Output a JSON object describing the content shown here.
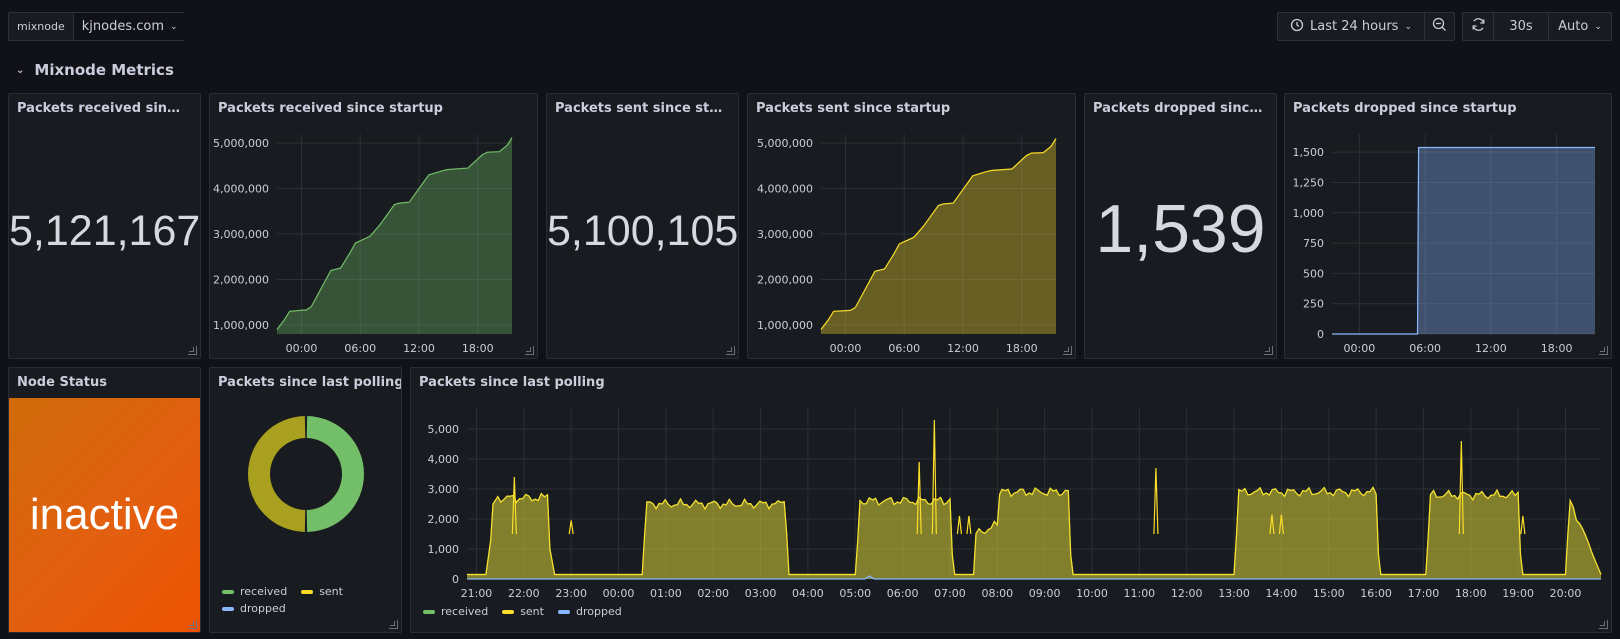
{
  "toolbar": {
    "variable_label": "mixnode",
    "variable_value": "kjnodes.com",
    "time_range": "Last 24 hours",
    "refresh_interval": "30s",
    "refresh_mode": "Auto"
  },
  "row": {
    "title": "Mixnode Metrics"
  },
  "colors": {
    "received": "#73bf69",
    "sent": "#fade2a",
    "dropped": "#8ab8ff",
    "inactive_bg": "#e35f10"
  },
  "panels": {
    "received_stat": {
      "title": "Packets received since...",
      "value": "5,121,167"
    },
    "received_chart": {
      "title": "Packets received since startup"
    },
    "sent_stat": {
      "title": "Packets sent since star...",
      "value": "5,100,105"
    },
    "sent_chart": {
      "title": "Packets sent since startup"
    },
    "dropped_stat": {
      "title": "Packets dropped since ...",
      "value": "1,539"
    },
    "dropped_chart": {
      "title": "Packets dropped since startup"
    },
    "node_status": {
      "title": "Node Status",
      "value": "inactive"
    },
    "donut": {
      "title": "Packets since last polling",
      "legend": [
        "received",
        "sent",
        "dropped"
      ]
    },
    "polling_chart": {
      "title": "Packets since last polling",
      "legend": [
        "received",
        "sent",
        "dropped"
      ]
    }
  },
  "chart_data": [
    {
      "type": "area",
      "title": "Packets received since startup",
      "x_ticks": [
        "00:00",
        "06:00",
        "12:00",
        "18:00"
      ],
      "y_ticks": [
        "1,000,000",
        "2,000,000",
        "3,000,000",
        "4,000,000",
        "5,000,000"
      ],
      "ylim": [
        800000,
        5200000
      ],
      "xlim": [
        -2.5,
        21.5
      ],
      "series": [
        {
          "name": "received",
          "x": [
            -2.5,
            -1.8,
            -1.2,
            0.5,
            1,
            3,
            4,
            5,
            5.5,
            7,
            8,
            9.5,
            10,
            11,
            13,
            14.5,
            15,
            17,
            18.5,
            19,
            20.2,
            21,
            21.5
          ],
          "y": [
            900000,
            1100000,
            1300000,
            1330000,
            1400000,
            2200000,
            2250000,
            2600000,
            2800000,
            2950000,
            3200000,
            3650000,
            3680000,
            3700000,
            4300000,
            4400000,
            4420000,
            4450000,
            4750000,
            4800000,
            4810000,
            4950000,
            5121167
          ]
        }
      ]
    },
    {
      "type": "area",
      "title": "Packets sent since startup",
      "x_ticks": [
        "00:00",
        "06:00",
        "12:00",
        "18:00"
      ],
      "y_ticks": [
        "1,000,000",
        "2,000,000",
        "3,000,000",
        "4,000,000",
        "5,000,000"
      ],
      "ylim": [
        800000,
        5200000
      ],
      "xlim": [
        -2.5,
        21.5
      ],
      "series": [
        {
          "name": "sent",
          "x": [
            -2.5,
            -1.8,
            -1.2,
            0.5,
            1,
            3,
            4,
            5,
            5.5,
            7,
            8,
            9.5,
            10,
            11,
            13,
            14.5,
            15,
            17,
            18.5,
            19,
            20.2,
            21,
            21.5
          ],
          "y": [
            900000,
            1100000,
            1300000,
            1320000,
            1380000,
            2180000,
            2230000,
            2580000,
            2780000,
            2930000,
            3180000,
            3630000,
            3660000,
            3680000,
            4280000,
            4380000,
            4400000,
            4430000,
            4730000,
            4780000,
            4790000,
            4930000,
            5100105
          ]
        }
      ]
    },
    {
      "type": "area",
      "title": "Packets dropped since startup",
      "x_ticks": [
        "00:00",
        "06:00",
        "12:00",
        "18:00"
      ],
      "y_ticks": [
        "0",
        "250",
        "500",
        "750",
        "1,000",
        "1,250",
        "1,500"
      ],
      "ylim": [
        0,
        1650
      ],
      "xlim": [
        -2.5,
        21.5
      ],
      "series": [
        {
          "name": "dropped",
          "x": [
            -2.5,
            5.3,
            5.4,
            21.5
          ],
          "y": [
            0,
            0,
            1539,
            1539
          ]
        }
      ]
    },
    {
      "type": "pie",
      "title": "Packets since last polling",
      "categories": [
        "received",
        "sent",
        "dropped"
      ],
      "values": [
        50,
        50,
        0
      ]
    },
    {
      "type": "area",
      "title": "Packets since last polling",
      "x_ticks": [
        "21:00",
        "22:00",
        "23:00",
        "00:00",
        "01:00",
        "02:00",
        "03:00",
        "04:00",
        "05:00",
        "06:00",
        "07:00",
        "08:00",
        "09:00",
        "10:00",
        "11:00",
        "12:00",
        "13:00",
        "14:00",
        "15:00",
        "16:00",
        "17:00",
        "18:00",
        "19:00",
        "20:00"
      ],
      "y_ticks": [
        "0",
        "1,000",
        "2,000",
        "3,000",
        "4,000",
        "5,000"
      ],
      "ylim": [
        0,
        5700
      ],
      "xlim": [
        -0.2,
        23.75
      ],
      "series": [
        {
          "name": "received",
          "x": [
            -0.2,
            0.2,
            0.3,
            0.35,
            0.45,
            1.5,
            1.55,
            1.65,
            3.5,
            3.55,
            3.6,
            6.5,
            6.55,
            6.6,
            8.0,
            8.05,
            8.1,
            10.0,
            10.05,
            10.1,
            10.5,
            10.55,
            11.0,
            11.05,
            11.1,
            12.5,
            12.55,
            12.6,
            16.0,
            16.05,
            16.1,
            19.0,
            19.05,
            19.1,
            20.05,
            20.1,
            20.15,
            22.0,
            22.05,
            22.1,
            23.0,
            23.05,
            23.1,
            23.75
          ],
          "y": [
            150,
            150,
            1200,
            2600,
            2700,
            2700,
            1000,
            150,
            150,
            1500,
            2500,
            2500,
            1500,
            150,
            150,
            1200,
            2600,
            2600,
            800,
            150,
            150,
            1500,
            1800,
            2900,
            2900,
            2900,
            800,
            150,
            150,
            1500,
            2900,
            2900,
            800,
            150,
            150,
            1500,
            2800,
            2800,
            800,
            150,
            150,
            1500,
            2600,
            150
          ]
        },
        {
          "name": "sent",
          "x": [
            -0.2,
            0.2,
            0.3,
            0.35,
            0.45,
            1.5,
            1.55,
            1.65,
            3.5,
            3.55,
            3.6,
            6.5,
            6.55,
            6.6,
            8.0,
            8.05,
            8.1,
            10.0,
            10.05,
            10.1,
            10.5,
            10.55,
            11.0,
            11.05,
            11.1,
            12.5,
            12.55,
            12.6,
            16.0,
            16.05,
            16.1,
            19.0,
            19.05,
            19.1,
            20.05,
            20.1,
            20.15,
            22.0,
            22.05,
            22.1,
            23.0,
            23.05,
            23.1,
            23.75
          ],
          "y": [
            150,
            150,
            1200,
            2600,
            2700,
            2700,
            1000,
            150,
            150,
            1500,
            2500,
            2500,
            1500,
            150,
            150,
            1200,
            2600,
            2600,
            800,
            150,
            150,
            1500,
            1800,
            2900,
            2900,
            2900,
            800,
            150,
            150,
            1500,
            2900,
            2900,
            800,
            150,
            150,
            1500,
            2800,
            2800,
            800,
            150,
            150,
            1500,
            2600,
            150
          ]
        },
        {
          "name": "dropped",
          "x": [
            -0.2,
            8.2,
            8.3,
            8.4,
            23.75
          ],
          "y": [
            0,
            0,
            100,
            0,
            0
          ]
        }
      ]
    }
  ]
}
